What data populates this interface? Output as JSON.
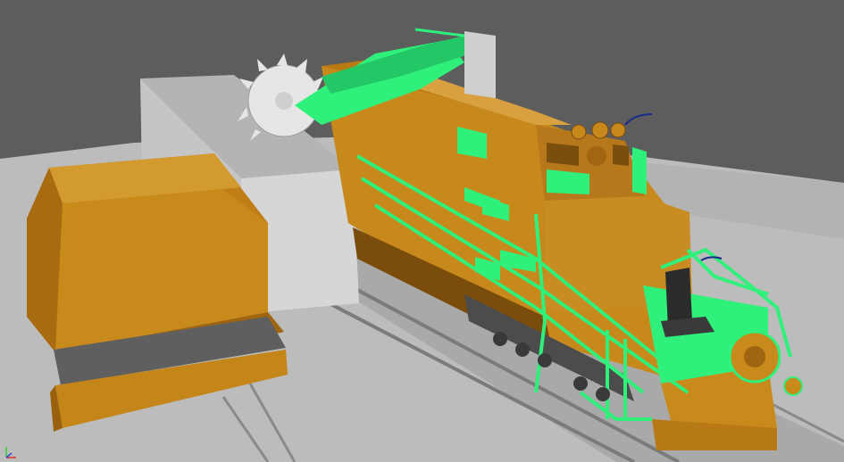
{
  "viewport": {
    "view": "perspective"
  },
  "scene": {
    "objects": [
      "ground-plane",
      "rail-track",
      "locomotive",
      "concrete-platform",
      "tender-car",
      "circular-saw"
    ]
  },
  "colors": {
    "background": "#5d5d5d",
    "ground": "#bdbdbd",
    "body_orange": "#c98a1c",
    "body_dark": "#8d5c0d",
    "selection_green": "#2ff07a",
    "platform": "#c8c8c8"
  },
  "axis_gizmo": {
    "x_color": "#e03030",
    "y_color": "#30d030",
    "z_color": "#3040e0"
  }
}
